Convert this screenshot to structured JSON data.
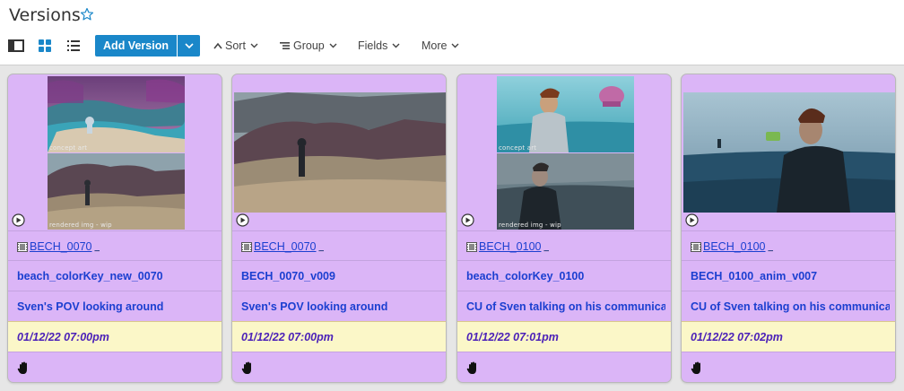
{
  "header": {
    "title": "Versions"
  },
  "toolbar": {
    "add_label": "Add Version",
    "sort_label": "Sort",
    "group_label": "Group",
    "fields_label": "Fields",
    "more_label": "More"
  },
  "cards": [
    {
      "shot": "BECH_0070",
      "version": "beach_colorKey_new_0070",
      "description": "Sven's POV looking around",
      "date": "01/12/22 07:00pm",
      "captions": [
        "concept art",
        "rendered img - wip"
      ]
    },
    {
      "shot": "BECH_0070",
      "version": "BECH_0070_v009",
      "description": "Sven's POV looking around",
      "date": "01/12/22 07:00pm"
    },
    {
      "shot": "BECH_0100",
      "version": "beach_colorKey_0100",
      "description": "CU of Sven talking on his communicato",
      "date": "01/12/22 07:01pm",
      "captions": [
        "concept art",
        "rendered img - wip"
      ]
    },
    {
      "shot": "BECH_0100",
      "version": "BECH_0100_anim_v007",
      "description": "CU of Sven talking on his communicato",
      "date": "01/12/22 07:02pm"
    }
  ],
  "colors": {
    "card_bg": "#dbb5f7",
    "date_bg": "#fbf7c8",
    "link": "#1b3fd0",
    "date_text": "#4b21b8",
    "primary_button": "#1a87c9"
  },
  "icons": [
    "star-icon",
    "panel-view-icon",
    "thumbnail-view-icon",
    "list-view-icon",
    "chevron-down-icon",
    "sort-icon",
    "group-icon",
    "play-icon",
    "film-icon",
    "hand-icon"
  ]
}
